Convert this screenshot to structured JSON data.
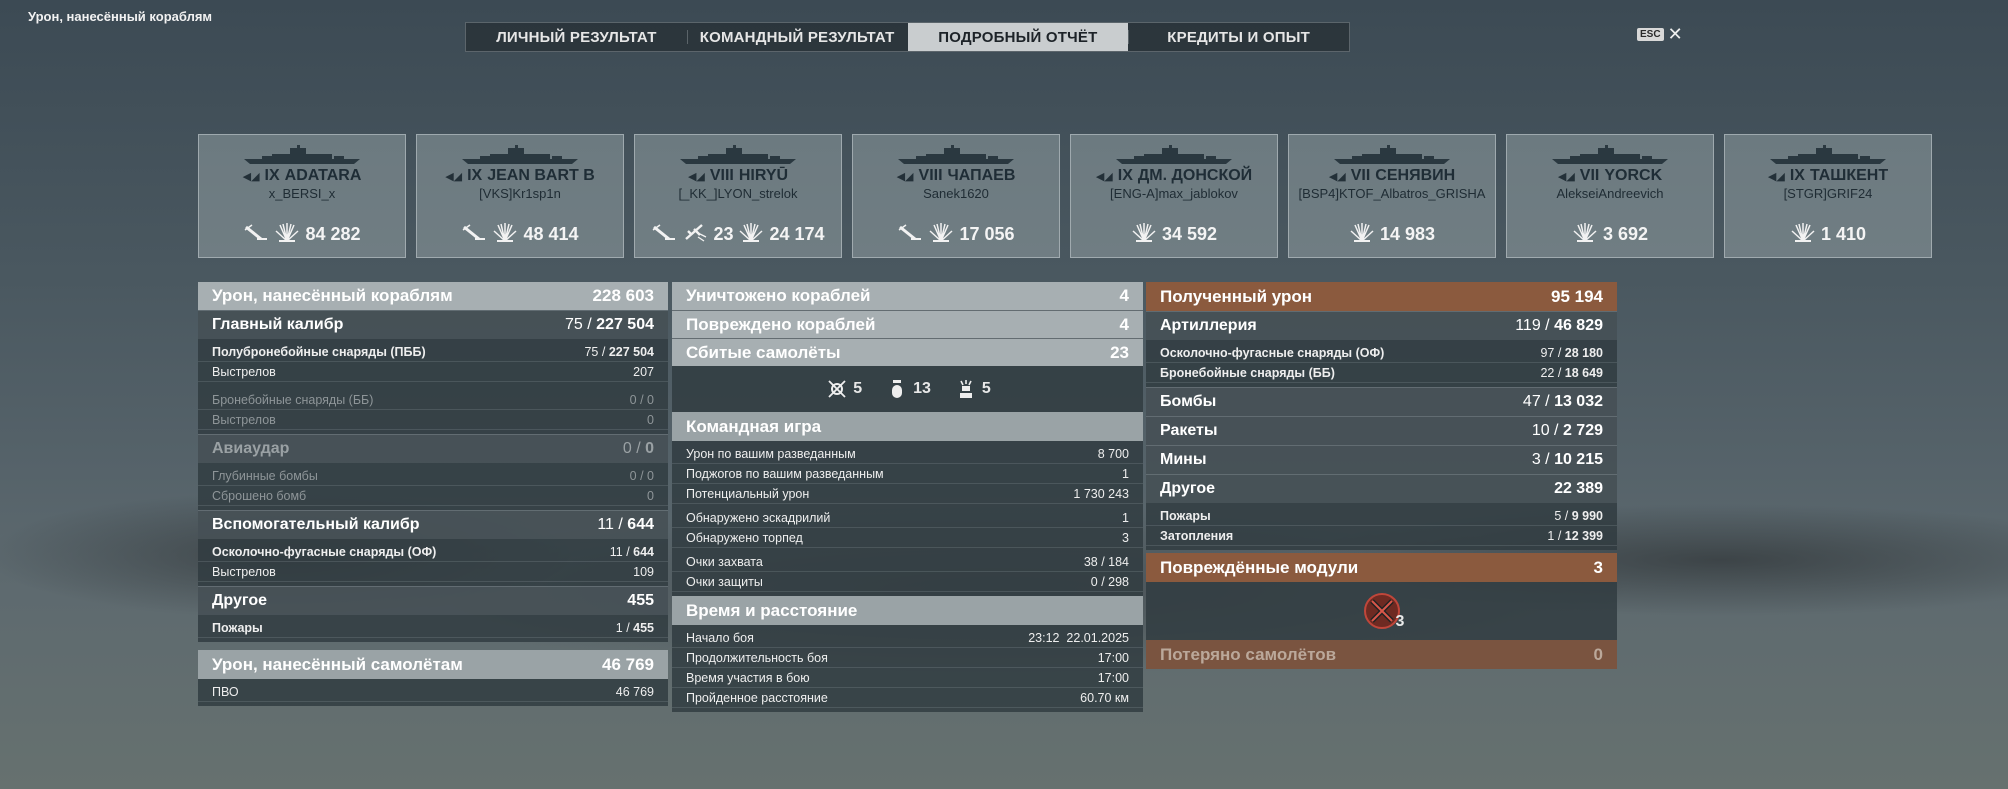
{
  "screen_title": "Урон, нанесённый кораблям",
  "tabs": [
    {
      "label": "ЛИЧНЫЙ РЕЗУЛЬТАТ",
      "active": false
    },
    {
      "label": "КОМАНДНЫЙ РЕЗУЛЬТАТ",
      "active": false
    },
    {
      "label": "ПОДРОБНЫЙ ОТЧЁТ",
      "active": true
    },
    {
      "label": "КРЕДИТЫ И ОПЫТ",
      "active": false
    }
  ],
  "close": {
    "key": "ESC",
    "icon": "close-icon"
  },
  "ships": [
    {
      "tier": "IX",
      "name": "ADATARA",
      "player": "x_BERSI_x",
      "stats": [
        {
          "icon": "torpedo-hit-icon"
        },
        {
          "icon": "shell-hit-icon",
          "value": "84 282"
        }
      ]
    },
    {
      "tier": "IX",
      "name": "JEAN BART B",
      "player": "[VKS]Kr1sp1n",
      "stats": [
        {
          "icon": "torpedo-hit-icon"
        },
        {
          "icon": "shell-hit-icon",
          "value": "48 414"
        }
      ]
    },
    {
      "tier": "VIII",
      "name": "HIRYŪ",
      "player": "[_KK_]LYON_strelok",
      "stats": [
        {
          "icon": "torpedo-hit-icon"
        },
        {
          "icon": "plane-shot-icon",
          "value": "23"
        },
        {
          "icon": "shell-hit-icon",
          "value": "24 174"
        }
      ]
    },
    {
      "tier": "VIII",
      "name": "ЧАПАЕВ",
      "player": "Sanek1620",
      "stats": [
        {
          "icon": "torpedo-hit-icon"
        },
        {
          "icon": "shell-hit-icon",
          "value": "17 056"
        }
      ]
    },
    {
      "tier": "IX",
      "name": "ДМ. ДОНСКОЙ",
      "player": "[ENG-A]max_jablokov",
      "stats": [
        {
          "icon": "shell-hit-icon",
          "value": "34 592"
        }
      ]
    },
    {
      "tier": "VII",
      "name": "СЕНЯВИН",
      "player": "[BSP4]KTOF_Albatros_GRISHA",
      "stats": [
        {
          "icon": "shell-hit-icon",
          "value": "14 983"
        }
      ]
    },
    {
      "tier": "VII",
      "name": "YORCK",
      "player": "AlekseiAndreevich",
      "stats": [
        {
          "icon": "shell-hit-icon",
          "value": "3 692"
        }
      ]
    },
    {
      "tier": "IX",
      "name": "ТАШКЕНТ",
      "player": "[STGR]GRIF24",
      "stats": [
        {
          "icon": "shell-hit-icon",
          "value": "1 410"
        }
      ]
    }
  ],
  "col1": {
    "damage_header": {
      "label": "Урон, нанесённый кораблям",
      "value": "228 603"
    },
    "main_battery": {
      "label": "Главный калибр",
      "hits": "75",
      "damage": "227 504"
    },
    "ap_shells": {
      "label": "Полубронебойные снаряды (ПББ)",
      "hits": "75",
      "damage": "227 504"
    },
    "shots1": {
      "label": "Выстрелов",
      "value": "207"
    },
    "ap_shells2": {
      "label": "Бронебойные снаряды (ББ)",
      "hits": "0",
      "damage": "0"
    },
    "shots2": {
      "label": "Выстрелов",
      "value": "0"
    },
    "airstrike": {
      "label": "Авиаудар",
      "hits": "0",
      "damage": "0"
    },
    "depth_charges": {
      "label": "Глубинные бомбы",
      "hits": "0",
      "damage": "0"
    },
    "bombs_dropped": {
      "label": "Сброшено бомб",
      "value": "0"
    },
    "secondary": {
      "label": "Вспомогательный калибр",
      "hits": "11",
      "damage": "644"
    },
    "he_shells": {
      "label": "Осколочно-фугасные снаряды (ОФ)",
      "hits": "11",
      "damage": "644"
    },
    "shots3": {
      "label": "Выстрелов",
      "value": "109"
    },
    "other": {
      "label": "Другое",
      "value": "455"
    },
    "fires": {
      "label": "Пожары",
      "hits": "1",
      "damage": "455"
    },
    "plane_damage": {
      "label": "Урон, нанесённый самолётам",
      "value": "46 769"
    },
    "aa": {
      "label": "ПВО",
      "value": "46 769"
    }
  },
  "col2": {
    "ships_destroyed": {
      "label": "Уничтожено кораблей",
      "value": "4"
    },
    "ships_damaged": {
      "label": "Повреждено кораблей",
      "value": "4"
    },
    "planes_shot": {
      "label": "Сбитые самолёты",
      "value": "23"
    },
    "planes_breakdown": [
      {
        "icon": "fighter-icon",
        "value": "5"
      },
      {
        "icon": "bomber-icon",
        "value": "13"
      },
      {
        "icon": "torpedo-bomber-icon",
        "value": "5"
      }
    ],
    "team_play": {
      "title": "Командная игра",
      "rows": [
        {
          "label": "Урон по вашим разведанным",
          "value": "8 700"
        },
        {
          "label": "Поджогов по вашим разведанным",
          "value": "1"
        },
        {
          "label": "Потенциальный урон",
          "value": "1 730 243"
        },
        {
          "label": "Обнаружено эскадрилий",
          "value": "1"
        },
        {
          "label": "Обнаружено торпед",
          "value": "3"
        },
        {
          "label": "Очки захвата",
          "value": "38 / 184"
        },
        {
          "label": "Очки защиты",
          "value": "0 / 298"
        }
      ]
    },
    "time": {
      "title": "Время и расстояние",
      "rows": [
        {
          "label": "Начало боя",
          "value": "23:12  22.01.2025"
        },
        {
          "label": "Продолжительность боя",
          "value": "17:00"
        },
        {
          "label": "Время участия в бою",
          "value": "17:00"
        },
        {
          "label": "Пройденное расстояние",
          "value": "60.70 км"
        }
      ]
    }
  },
  "col3": {
    "received": {
      "label": "Полученный урон",
      "value": "95 194"
    },
    "artillery": {
      "label": "Артиллерия",
      "hits": "119",
      "damage": "46 829"
    },
    "he": {
      "label": "Осколочно-фугасные снаряды (ОФ)",
      "hits": "97",
      "damage": "28 180"
    },
    "ap": {
      "label": "Бронебойные снаряды (ББ)",
      "hits": "22",
      "damage": "18 649"
    },
    "bombs": {
      "label": "Бомбы",
      "hits": "47",
      "damage": "13 032"
    },
    "rockets": {
      "label": "Ракеты",
      "hits": "10",
      "damage": "2 729"
    },
    "mines": {
      "label": "Мины",
      "hits": "3",
      "damage": "10 215"
    },
    "other": {
      "label": "Другое",
      "value": "22 389"
    },
    "fires": {
      "label": "Пожары",
      "hits": "5",
      "damage": "9 990"
    },
    "floods": {
      "label": "Затопления",
      "hits": "1",
      "damage": "12 399"
    },
    "modules": {
      "label": "Повреждённые модули",
      "value": "3",
      "icon": "damaged-module-icon",
      "count": "3"
    },
    "planes_lost": {
      "label": "Потеряно самолётов",
      "value": "0"
    }
  }
}
